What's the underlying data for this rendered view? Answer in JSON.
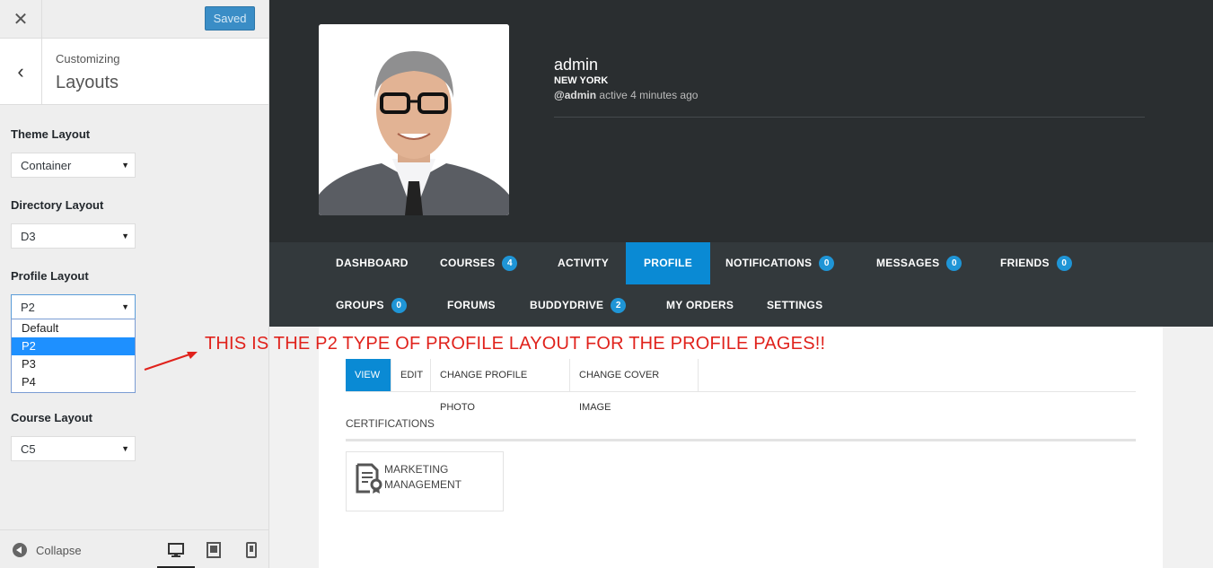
{
  "customizer": {
    "close_icon": "close-icon",
    "saved_label": "Saved",
    "back_icon": "chevron-left-icon",
    "section_sub": "Customizing",
    "section_title": "Layouts",
    "controls": {
      "theme_layout": {
        "label": "Theme Layout",
        "value": "Container"
      },
      "directory_layout": {
        "label": "Directory Layout",
        "value": "D3"
      },
      "profile_layout": {
        "label": "Profile Layout",
        "value": "P2",
        "options": [
          "Default",
          "P2",
          "P3",
          "P4"
        ]
      },
      "course_layout": {
        "label": "Course Layout",
        "value": "C5"
      }
    },
    "footer": {
      "collapse_label": "Collapse"
    }
  },
  "profile": {
    "username": "admin",
    "location": "NEW YORK",
    "handle": "@admin",
    "activity": "active 4 minutes ago"
  },
  "nav": {
    "items": [
      {
        "label": "DASHBOARD"
      },
      {
        "label": "COURSES",
        "badge": "4"
      },
      {
        "label": "ACTIVITY"
      },
      {
        "label": "PROFILE",
        "active": true
      },
      {
        "label": "NOTIFICATIONS",
        "badge": "0"
      },
      {
        "label": "MESSAGES",
        "badge": "0"
      },
      {
        "label": "FRIENDS",
        "badge": "0"
      },
      {
        "label": "GROUPS",
        "badge": "0"
      },
      {
        "label": "FORUMS"
      },
      {
        "label": "BUDDYDRIVE",
        "badge": "2"
      },
      {
        "label": "MY ORDERS"
      },
      {
        "label": "SETTINGS"
      }
    ]
  },
  "annotation": "THIS IS THE P2 TYPE OF PROFILE LAYOUT FOR THE PROFILE PAGES!!",
  "subnav": {
    "tabs": [
      {
        "label": "VIEW",
        "active": true
      },
      {
        "label": "EDIT"
      },
      {
        "label": "CHANGE PROFILE PHOTO"
      },
      {
        "label": "CHANGE COVER IMAGE"
      }
    ]
  },
  "certifications": {
    "heading": "CERTIFICATIONS",
    "items": [
      {
        "line1": "MARKETING",
        "line2": "MANAGEMENT"
      }
    ]
  },
  "colors": {
    "accent": "#0a8ad4",
    "annotation": "#e0221c",
    "cover": "#2a2e30",
    "navbar": "#33393c"
  }
}
